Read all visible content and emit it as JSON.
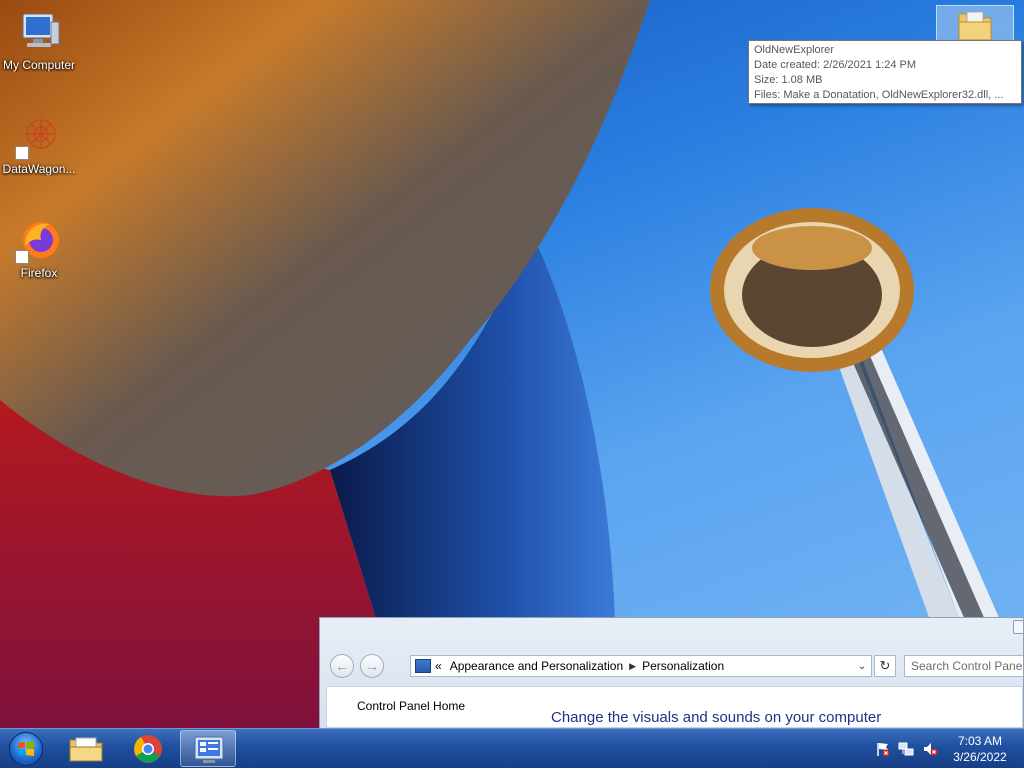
{
  "desktop": {
    "icons": [
      {
        "label": "My Computer",
        "icon": "computer-icon"
      },
      {
        "label": "DataWagon...",
        "icon": "datawagon-icon"
      },
      {
        "label": "Firefox",
        "icon": "firefox-icon"
      }
    ],
    "folder_icon": "folder-icon"
  },
  "tooltip": {
    "name": "OldNewExplorer",
    "date_created": "Date created: 2/26/2021 1:24 PM",
    "size": "Size: 1.08 MB",
    "files": "Files: Make a Donatation, OldNewExplorer32.dll, ..."
  },
  "control_panel": {
    "crumb_overflow": "«",
    "breadcrumb": [
      "Appearance and Personalization",
      "Personalization"
    ],
    "search_placeholder": "Search Control Panel",
    "sidebar_link": "Control Panel Home",
    "heading": "Change the visuals and sounds on your computer"
  },
  "taskbar": {
    "pinned": [
      {
        "icon": "file-explorer-icon"
      },
      {
        "icon": "chrome-icon"
      },
      {
        "icon": "control-panel-icon",
        "active": true
      }
    ],
    "tray_icons": [
      "action-center-flag-icon",
      "network-icon",
      "volume-muted-icon"
    ],
    "time": "7:03 AM",
    "date": "3/26/2022"
  }
}
